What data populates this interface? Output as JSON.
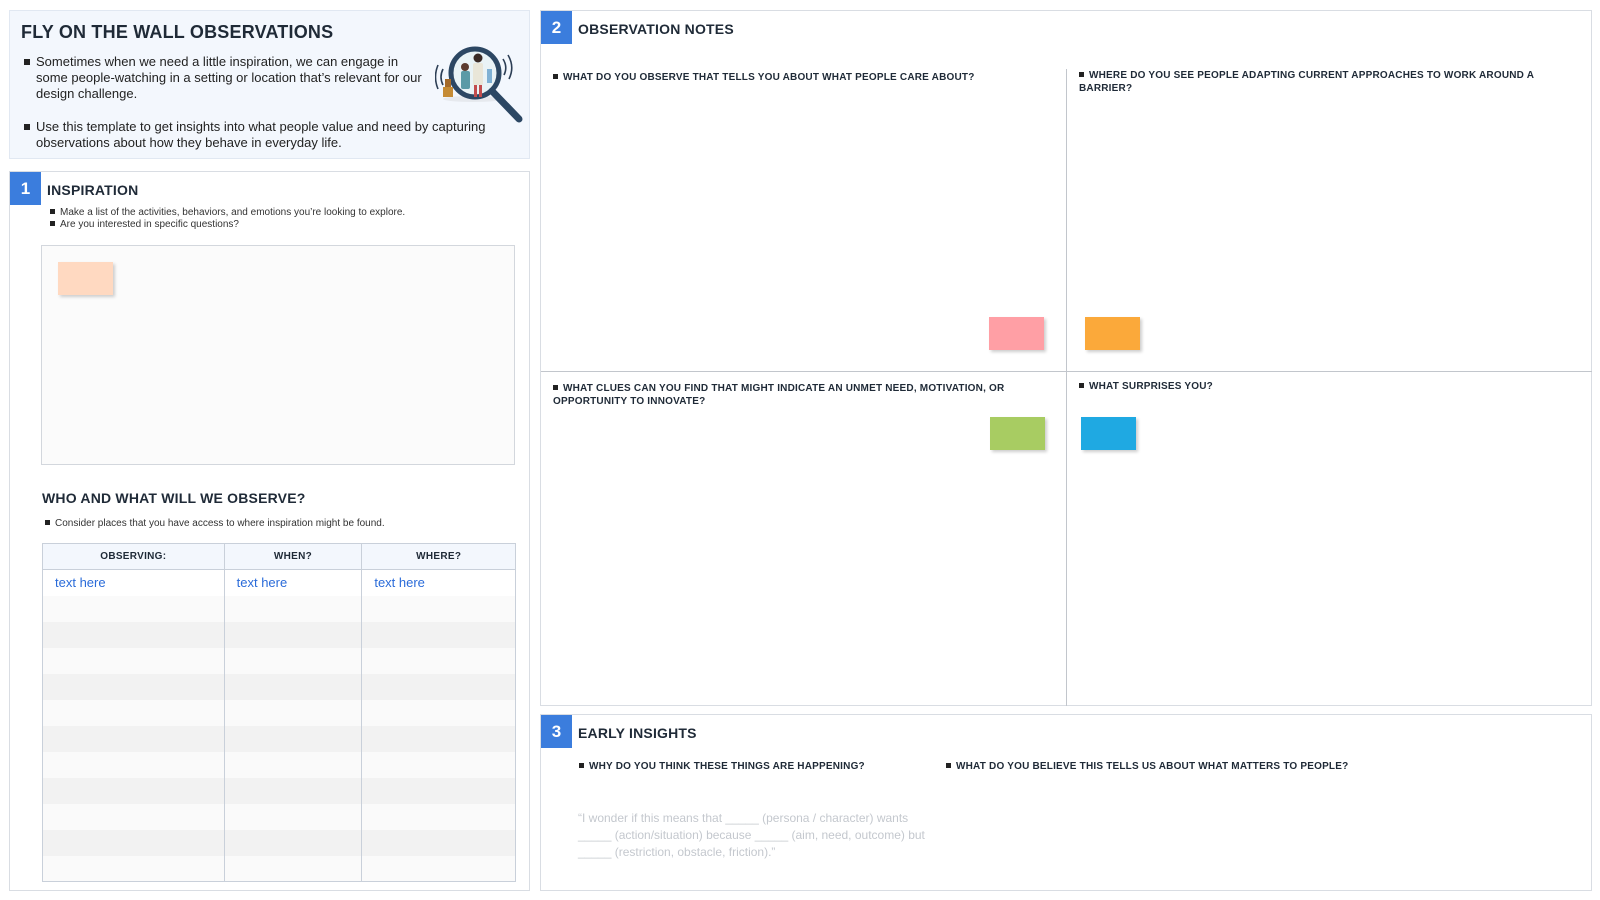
{
  "intro": {
    "title": "FLY ON THE WALL OBSERVATIONS",
    "bullets": [
      "Sometimes when we need a little inspiration, we can engage in some people-watching in a setting or location that’s relevant for our design challenge.",
      "Use this template to get insights into what people value and need by capturing observations about how they behave in everyday life."
    ],
    "illustration_icon": "magnifying-glass-people-icon"
  },
  "section1": {
    "number": "1",
    "title": "INSPIRATION",
    "bullets": [
      "Make a list of the activities, behaviors, and emotions you’re looking to explore.",
      "Are you interested in specific questions?"
    ],
    "sticky_color": "#ffd9c1",
    "who_title": "WHO AND WHAT WILL WE OBSERVE?",
    "who_bullet": "Consider places that you have access to where inspiration might be found.",
    "table": {
      "headers": [
        "OBSERVING:",
        "WHEN?",
        "WHERE?"
      ],
      "rows": [
        [
          "text here",
          "text here",
          "text here"
        ],
        [
          "",
          "",
          ""
        ],
        [
          "",
          "",
          ""
        ],
        [
          "",
          "",
          ""
        ],
        [
          "",
          "",
          ""
        ],
        [
          "",
          "",
          ""
        ],
        [
          "",
          "",
          ""
        ],
        [
          "",
          "",
          ""
        ],
        [
          "",
          "",
          ""
        ],
        [
          "",
          "",
          ""
        ],
        [
          "",
          "",
          ""
        ],
        [
          "",
          "",
          ""
        ]
      ]
    }
  },
  "section2": {
    "number": "2",
    "title": "OBSERVATION NOTES",
    "quadrants": [
      {
        "question": "WHAT DO YOU OBSERVE THAT TELLS YOU ABOUT WHAT PEOPLE CARE ABOUT?",
        "sticky_color": "#ff9fa5"
      },
      {
        "question": "WHERE DO YOU SEE PEOPLE ADAPTING CURRENT APPROACHES TO WORK AROUND A BARRIER?",
        "sticky_color": "#fba93a"
      },
      {
        "question": "WHAT CLUES CAN YOU FIND THAT MIGHT INDICATE AN UNMET NEED, MOTIVATION, OR OPPORTUNITY TO INNOVATE?",
        "sticky_color": "#a8cc62"
      },
      {
        "question": "WHAT SURPRISES YOU?",
        "sticky_color": "#1fa9e2"
      }
    ]
  },
  "section3": {
    "number": "3",
    "title": "EARLY INSIGHTS",
    "questions": [
      "WHY DO YOU THINK THESE THINGS ARE HAPPENING?",
      "WHAT DO YOU BELIEVE THIS TELLS US ABOUT WHAT MATTERS TO PEOPLE?"
    ],
    "prompt": "“I wonder if this means that _____ (persona / character) wants _____ (action/situation) because _____ (aim, need, outcome) but _____ (restriction, obstacle, friction).”"
  },
  "colors": {
    "accent": "#3b7ddd",
    "link_text": "#2a6bd9"
  }
}
